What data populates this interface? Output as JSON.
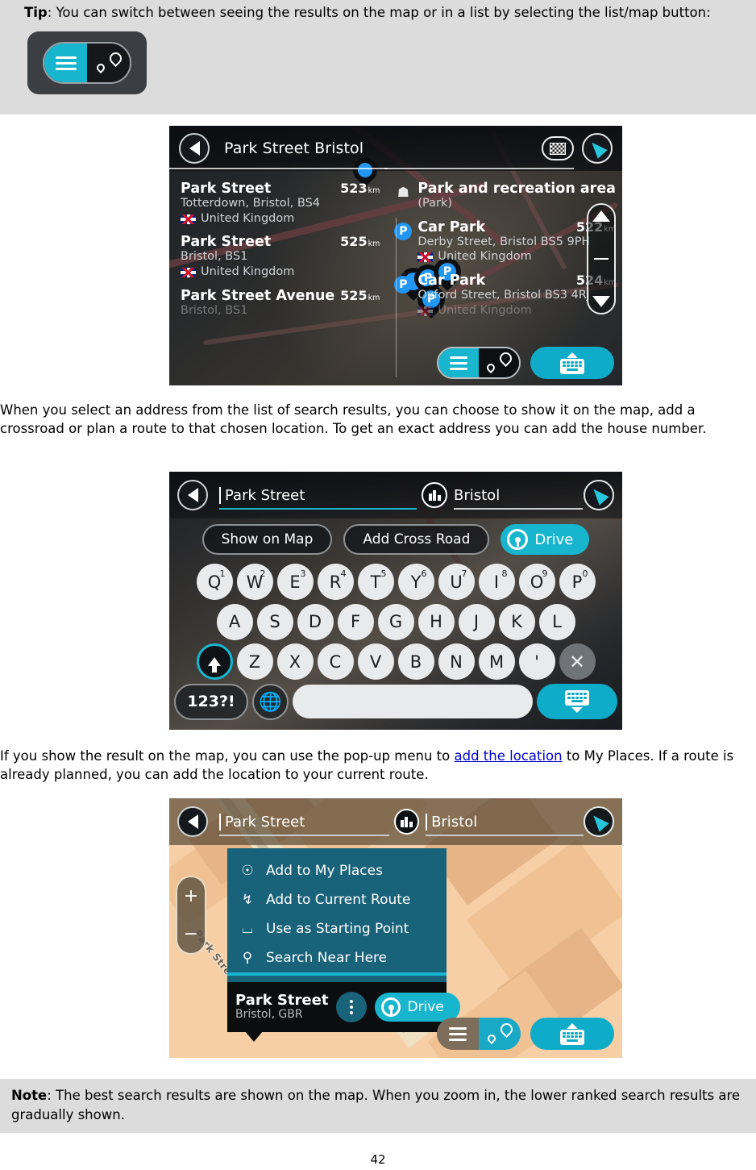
{
  "tip": {
    "lead": "Tip",
    "text": ": You can switch between seeing the results on the map or in a list by selecting the list/map button:"
  },
  "paragraph_1": "When you select an address from the list of search results, you can choose to show it on the map, add a crossroad or plan a route to that chosen location. To get an exact address you can add the house number.",
  "paragraph_2": {
    "before": "If you show the result on the map, you can use the pop-up menu to ",
    "link": "add the location",
    "after": " to My Places. If a route is already planned, you can add the location to your current route."
  },
  "note": {
    "lead": "Note",
    "text": ": The best search results are shown on the map. When you zoom in, the lower ranked search results are gradually shown."
  },
  "page_number": "42",
  "colors": {
    "accent_cyan": "#18b5cf",
    "popup_teal": "#18627a",
    "callout_grey": "#dcdcdc",
    "link_blue": "#0000cc",
    "poi_blue": "#2196f3"
  },
  "screenshot_1": {
    "title": "Park Street Bristol",
    "back_icon": "back-arrow-icon",
    "flag_icon": "checkered-flag-icon",
    "nav_icon": "navigation-arrow-icon",
    "results_left": [
      {
        "name": "Park Street",
        "distance": "523",
        "unit": "km",
        "address": "Totterdown, Bristol, BS4",
        "country": "United Kingdom",
        "flag": "uk-flag-icon"
      },
      {
        "name": "Park Street",
        "distance": "525",
        "unit": "km",
        "address": "Bristol, BS1",
        "country": "United Kingdom",
        "flag": "uk-flag-icon"
      },
      {
        "name": "Park Street Avenue",
        "distance": "525",
        "unit": "km",
        "address": "Bristol, BS1",
        "country": "",
        "flag": "uk-flag-icon"
      }
    ],
    "results_right": [
      {
        "icon": "park-tree-icon",
        "name": "Park and recreation area",
        "distance": "",
        "unit": "",
        "address": "(Park)",
        "country": "",
        "flag": ""
      },
      {
        "icon": "parking-icon",
        "name": "Car Park",
        "distance": "522",
        "unit": "km",
        "address": "Derby Street, Bristol BS5 9PH",
        "country": "United Kingdom",
        "flag": "uk-flag-icon"
      },
      {
        "icon": "parking-icon",
        "name": "Car Park",
        "distance": "524",
        "unit": "km",
        "address": "Oxford Street, Bristol BS3 4RJ",
        "country": "United Kingdom",
        "flag": "uk-flag-icon"
      }
    ],
    "map_pin_label": "P",
    "scroll_up_icon": "scroll-up-arrow-icon",
    "scroll_down_icon": "scroll-down-arrow-icon",
    "list_map_toggle": "list-map-toggle",
    "keyboard_button": "keyboard-icon"
  },
  "screenshot_2": {
    "street_field": "Park Street",
    "city_field": "Bristol",
    "city_icon": "city-buildings-icon",
    "back_icon": "back-arrow-icon",
    "nav_icon": "navigation-arrow-icon",
    "actions": [
      {
        "label": "Show on Map"
      },
      {
        "label": "Add Cross Road"
      }
    ],
    "drive_label": "Drive",
    "drive_icon": "steering-wheel-icon",
    "keyboard": {
      "row1": [
        {
          "letter": "Q",
          "num": "1"
        },
        {
          "letter": "W",
          "num": "2"
        },
        {
          "letter": "E",
          "num": "3"
        },
        {
          "letter": "R",
          "num": "4"
        },
        {
          "letter": "T",
          "num": "5"
        },
        {
          "letter": "Y",
          "num": "6"
        },
        {
          "letter": "U",
          "num": "7"
        },
        {
          "letter": "I",
          "num": "8"
        },
        {
          "letter": "O",
          "num": "9"
        },
        {
          "letter": "P",
          "num": "0"
        }
      ],
      "row2": [
        {
          "letter": "A"
        },
        {
          "letter": "S"
        },
        {
          "letter": "D"
        },
        {
          "letter": "F"
        },
        {
          "letter": "G"
        },
        {
          "letter": "H"
        },
        {
          "letter": "J"
        },
        {
          "letter": "K"
        },
        {
          "letter": "L"
        }
      ],
      "row3": [
        {
          "letter": "Z"
        },
        {
          "letter": "X"
        },
        {
          "letter": "C"
        },
        {
          "letter": "V"
        },
        {
          "letter": "B"
        },
        {
          "letter": "N"
        },
        {
          "letter": "M"
        },
        {
          "letter": "'"
        }
      ],
      "shift_icon": "shift-arrow-icon",
      "delete_icon": "delete-x-icon",
      "numbers_label": "123?!",
      "globe_icon": "globe-language-icon",
      "space_label": "",
      "hide_keyboard_icon": "keyboard-hide-icon"
    }
  },
  "screenshot_3": {
    "street_field": "Park Street",
    "city_field": "Bristol",
    "city_icon": "city-buildings-icon",
    "back_icon": "back-arrow-icon",
    "nav_icon": "navigation-arrow-icon",
    "zoom_in": "+",
    "zoom_out": "−",
    "street_label": "Park Street",
    "menu_items": [
      {
        "label": "Add to My Places",
        "icon": "add-place-pin-icon"
      },
      {
        "label": "Add to Current Route",
        "icon": "add-route-icon"
      },
      {
        "label": "Use as Starting Point",
        "icon": "starting-point-icon"
      },
      {
        "label": "Search Near Here",
        "icon": "search-near-icon"
      }
    ],
    "info_card": {
      "name": "Park Street",
      "sub": "Bristol, GBR",
      "more_icon": "more-dots-icon",
      "drive_label": "Drive",
      "drive_icon": "steering-wheel-icon"
    },
    "list_map_toggle": "list-map-toggle",
    "keyboard_button": "keyboard-icon"
  }
}
